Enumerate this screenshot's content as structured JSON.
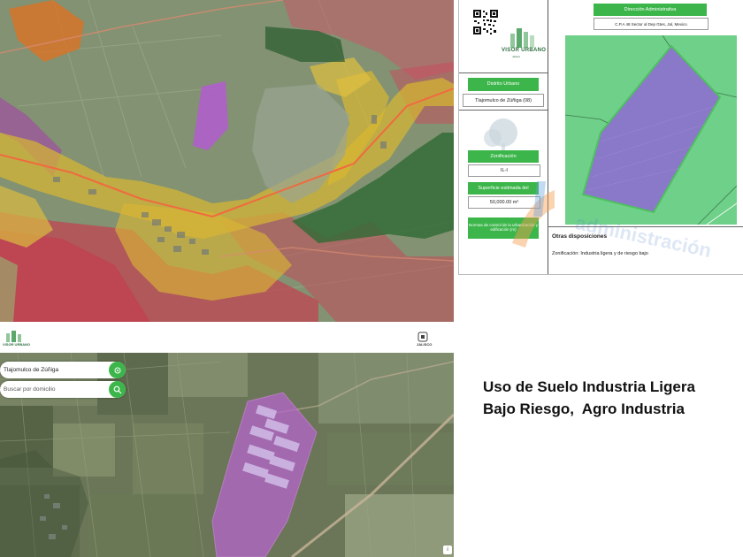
{
  "certificate": {
    "header_box": "Dirección Administrativa",
    "address_box": "C.P.A 48 Sector al Dep Gtes, Jal, Mexico",
    "logo_name": "VISOR URBANO",
    "logo_sub": "Jalisco",
    "district_label": "Distrito Urbano",
    "district_value": "Tlajomulco de Zúñiga (08)",
    "zoning_label": "Zonificación",
    "zoning_value": "IL-I",
    "area_label": "Superficie estimada del",
    "area_value": "50,000.00 m²",
    "normas_label": "Normas de control de la urbanización y edificación (m)",
    "other_title": "Otras disposiciones",
    "other_text": "Zonificación: Industria ligera y de riesgo bajo",
    "watermark": "administración"
  },
  "header": {
    "left_logo": "VISOR URBANO",
    "right_logo": "JALISCO"
  },
  "map": {
    "location_text": "Tlajomulco de Zúñiga",
    "search_placeholder": "Buscar por domicilio",
    "corner_label": "i"
  },
  "caption": {
    "line1": "Uso de Suelo Industria Ligera",
    "line2": "Bajo Riesgo,  Agro Industria"
  },
  "colors": {
    "accent": "#3cb64a",
    "industrial": "#b05fc8",
    "residential": "#e0c040",
    "commercial": "#e06020",
    "rural": "#d03050"
  },
  "icons": {
    "locate": "crosshair-icon",
    "search": "search-icon"
  }
}
